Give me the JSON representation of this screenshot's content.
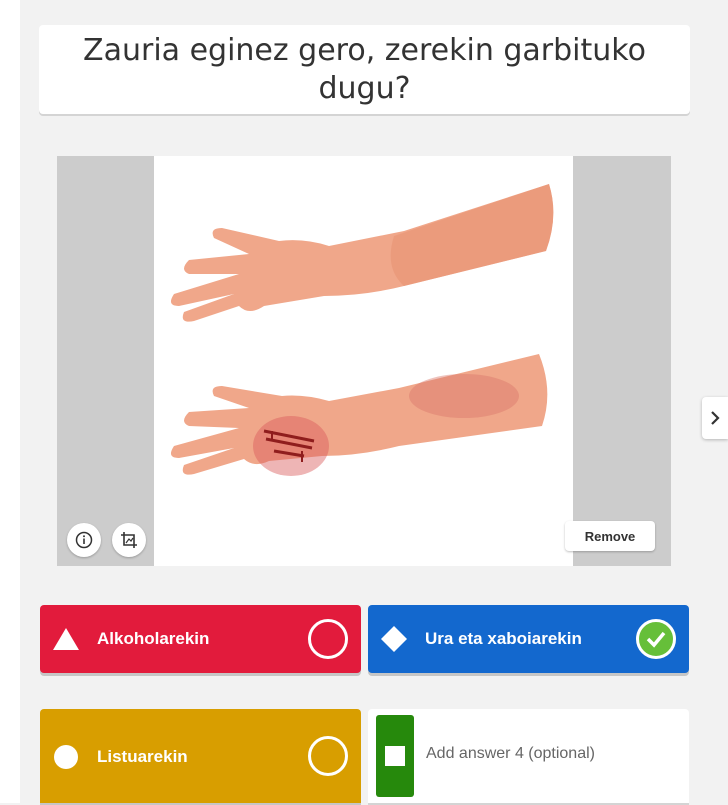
{
  "question": {
    "text": "Zauria eginez gero, zerekin garbituko dugu?"
  },
  "media": {
    "remove_label": "Remove",
    "info_icon": "info-icon",
    "crop_icon": "crop-icon"
  },
  "navigation": {
    "next_icon": "chevron-right-icon"
  },
  "answers": [
    {
      "label": "Alkoholarekin",
      "shape": "triangle",
      "color": "#e21b3c",
      "correct": false
    },
    {
      "label": "Ura eta xaboiarekin",
      "shape": "diamond",
      "color": "#1368ce",
      "correct": true
    },
    {
      "label": "Listuarekin",
      "shape": "circle",
      "color": "#d89e00",
      "correct": false
    },
    {
      "placeholder": "Add answer 4 (optional)",
      "shape": "square",
      "color": "#26890c"
    }
  ],
  "colors": {
    "correct_check": "#66bf39",
    "background": "#f2f2f2"
  }
}
